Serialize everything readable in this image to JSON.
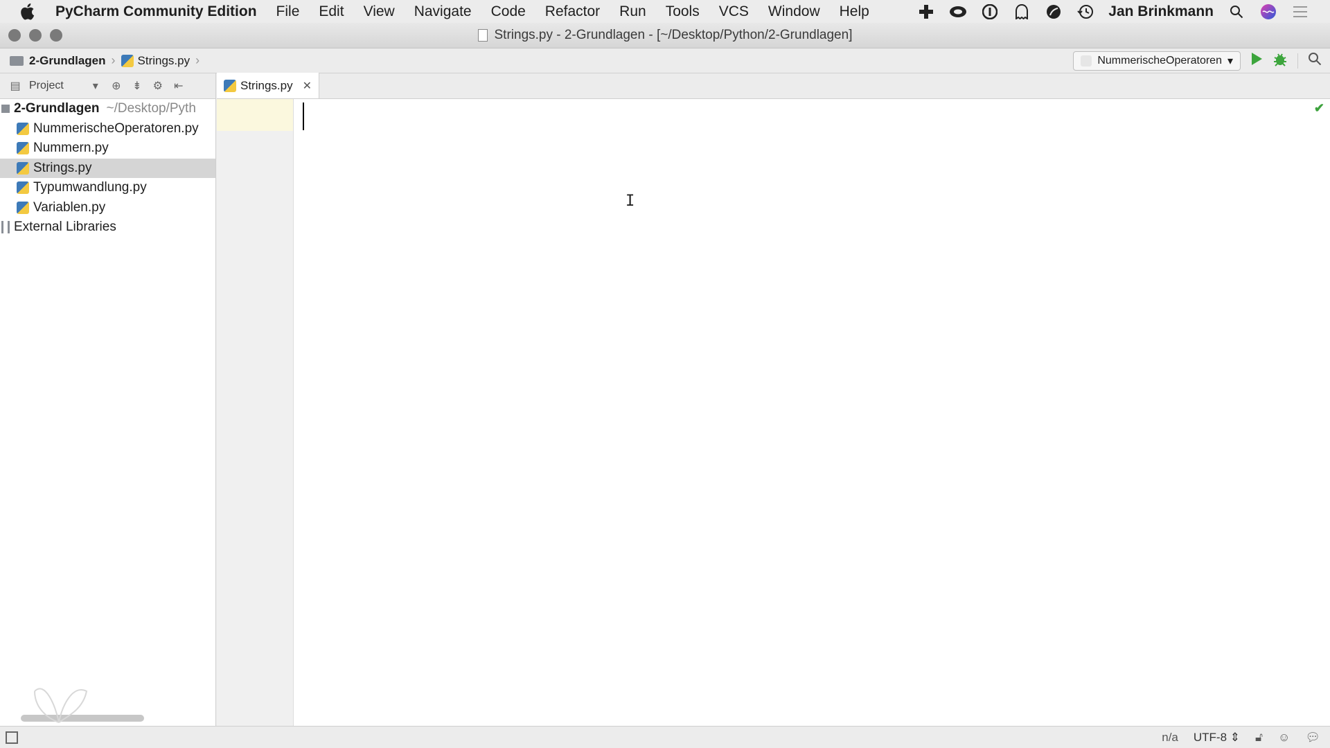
{
  "menubar": {
    "app_name": "PyCharm Community Edition",
    "items": [
      "File",
      "Edit",
      "View",
      "Navigate",
      "Code",
      "Refactor",
      "Run",
      "Tools",
      "VCS",
      "Window",
      "Help"
    ],
    "user": "Jan Brinkmann"
  },
  "window": {
    "title": "Strings.py - 2-Grundlagen - [~/Desktop/Python/2-Grundlagen]"
  },
  "navbar": {
    "project": "2-Grundlagen",
    "file": "Strings.py",
    "run_config": "NummerischeOperatoren"
  },
  "project_panel": {
    "view_label": "Project",
    "root_name": "2-Grundlagen",
    "root_path": "~/Desktop/Pyth",
    "files": [
      "NummerischeOperatoren.py",
      "Nummern.py",
      "Strings.py",
      "Typumwandlung.py",
      "Variablen.py"
    ],
    "selected_file": "Strings.py",
    "external_libraries": "External Libraries"
  },
  "editor": {
    "tab_label": "Strings.py",
    "content": ""
  },
  "statusbar": {
    "position": "n/a",
    "encoding": "UTF-8"
  },
  "colors": {
    "run_green": "#3ca53c",
    "selection_gray": "#d5d5d5",
    "current_line": "#fbf8de"
  }
}
